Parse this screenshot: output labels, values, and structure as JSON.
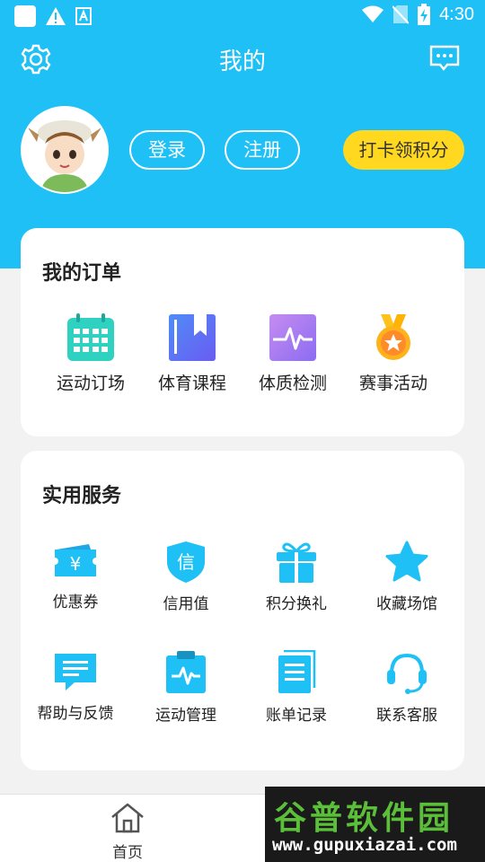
{
  "status_bar": {
    "time": "4:30"
  },
  "header": {
    "title": "我的",
    "login": "登录",
    "register": "注册",
    "checkin": "打卡领积分"
  },
  "orders": {
    "title": "我的订单",
    "items": [
      {
        "label": "运动订场",
        "icon": "calendar-icon"
      },
      {
        "label": "体育课程",
        "icon": "book-icon"
      },
      {
        "label": "体质检测",
        "icon": "heartbeat-monitor-icon"
      },
      {
        "label": "赛事活动",
        "icon": "medal-icon"
      }
    ]
  },
  "services": {
    "title": "实用服务",
    "items": [
      {
        "label": "优惠券",
        "icon": "coupon-icon",
        "glyph": "¥"
      },
      {
        "label": "信用值",
        "icon": "credit-shield-icon",
        "glyph": "信"
      },
      {
        "label": "积分换礼",
        "icon": "gift-icon"
      },
      {
        "label": "收藏场馆",
        "icon": "star-icon"
      },
      {
        "label": "帮助与反馈",
        "icon": "feedback-icon"
      },
      {
        "label": "运动管理",
        "icon": "clipboard-pulse-icon"
      },
      {
        "label": "账单记录",
        "icon": "bill-icon"
      },
      {
        "label": "联系客服",
        "icon": "headset-icon"
      }
    ]
  },
  "bottom_nav": {
    "home": "首页"
  },
  "watermark": {
    "title": "谷普软件园",
    "url": "www.gupuxiazai.com"
  },
  "colors": {
    "primary": "#1ec0f5",
    "accent_yellow": "#ffd81f"
  }
}
